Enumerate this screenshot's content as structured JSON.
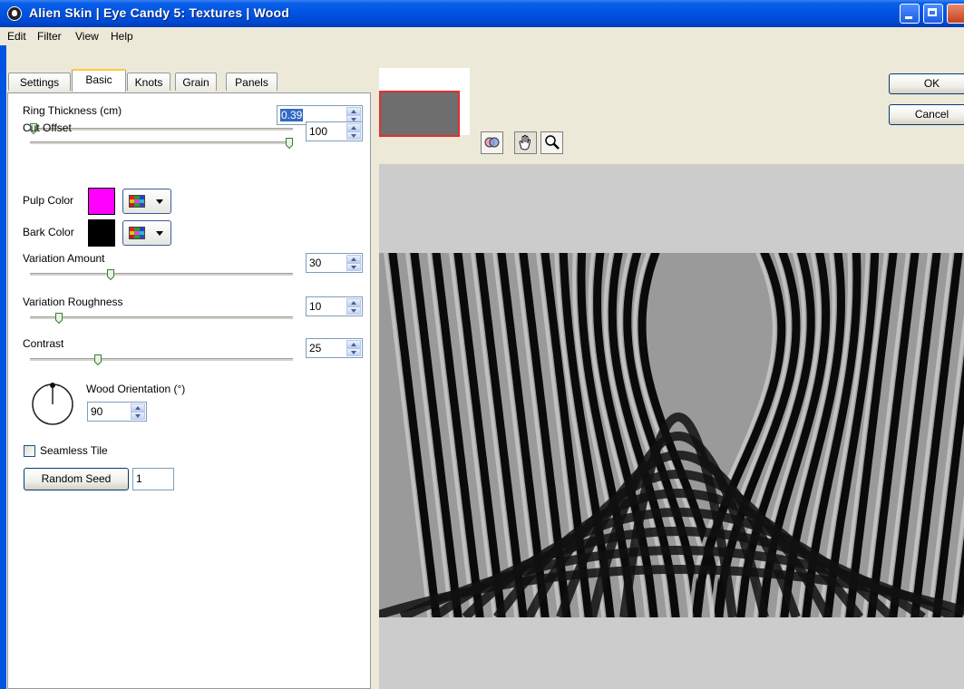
{
  "window": {
    "title": "Alien Skin  |  Eye Candy 5: Textures  |  Wood"
  },
  "menu": [
    "Edit",
    "Filter",
    "View",
    "Help"
  ],
  "tabs": [
    "Settings",
    "Basic",
    "Knots",
    "Grain",
    "Panels"
  ],
  "active_tab": "Basic",
  "controls": {
    "ring_thickness": {
      "label": "Ring Thickness (cm)",
      "value": "0.39",
      "slider_fraction": 0.0
    },
    "cut_offset": {
      "label": "Cut Offset",
      "value": "100",
      "slider_fraction": 1.0
    },
    "pulp_color": {
      "label": "Pulp Color",
      "color": "#ff00ff"
    },
    "bark_color": {
      "label": "Bark Color",
      "color": "#000000"
    },
    "variation_amount": {
      "label": "Variation Amount",
      "value": "30",
      "slider_fraction": 0.3
    },
    "variation_roughness": {
      "label": "Variation Roughness",
      "value": "10",
      "slider_fraction": 0.1
    },
    "contrast": {
      "label": "Contrast",
      "value": "25",
      "slider_fraction": 0.25
    },
    "wood_orientation": {
      "label": "Wood Orientation (°)",
      "value": "90"
    },
    "seamless_tile": {
      "label": "Seamless Tile",
      "checked": false
    },
    "random_seed": {
      "label": "Random Seed",
      "value": "1"
    }
  },
  "buttons": {
    "ok": "OK",
    "cancel": "Cancel"
  },
  "tools": [
    "preview-compare-icon",
    "hand-pan-icon",
    "zoom-magnifier-icon"
  ],
  "colors": {
    "titlebar": "#0054e3",
    "preview_border": "#e03030",
    "canvas": "#cccccc"
  }
}
